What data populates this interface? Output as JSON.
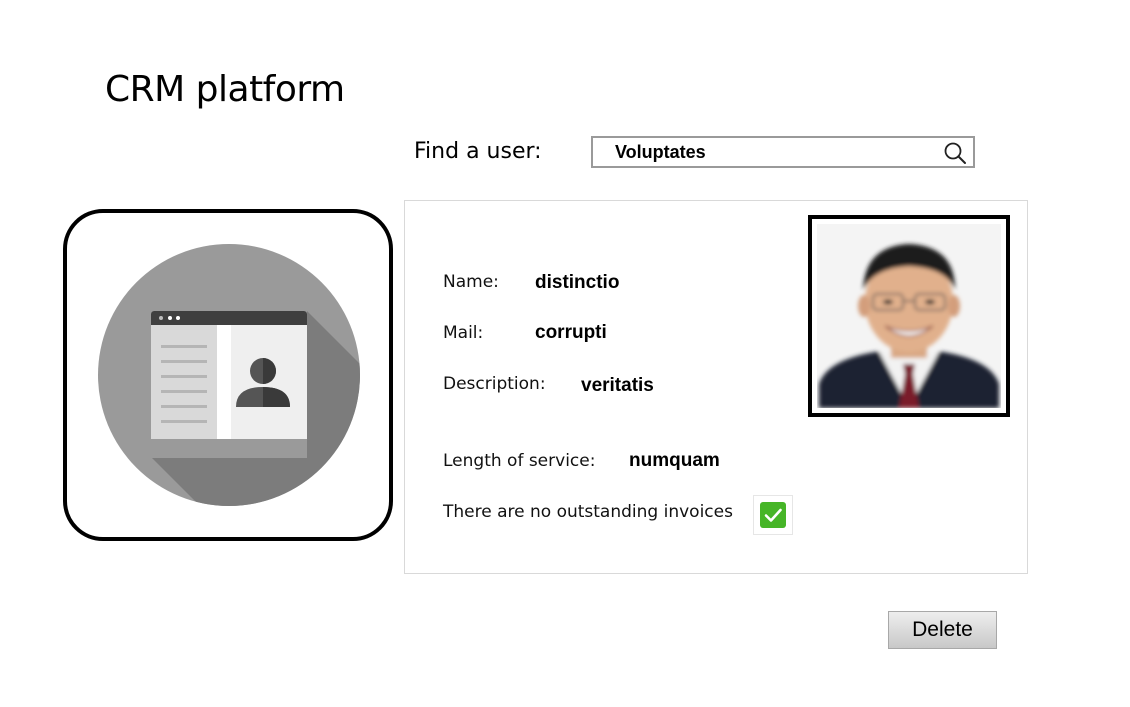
{
  "app": {
    "title": "CRM platform"
  },
  "search": {
    "label": "Find a user:",
    "value": "Voluptates",
    "icon": "search-icon"
  },
  "user": {
    "avatar_icon": "contact-card-icon",
    "photo": "user-photo",
    "fields": {
      "name": {
        "label": "Name:",
        "value": "distinctio"
      },
      "mail": {
        "label": "Mail:",
        "value": "corrupti"
      },
      "description": {
        "label": "Description:",
        "value": "veritatis"
      },
      "length_of_service": {
        "label": "Length of service:",
        "value": "numquam"
      }
    },
    "invoices": {
      "label": "There are no outstanding invoices",
      "checked": true
    }
  },
  "actions": {
    "delete_label": "Delete"
  },
  "colors": {
    "check_green": "#46b527",
    "avatar_circle": "#9a9a9a",
    "frame_border": "#000000"
  }
}
